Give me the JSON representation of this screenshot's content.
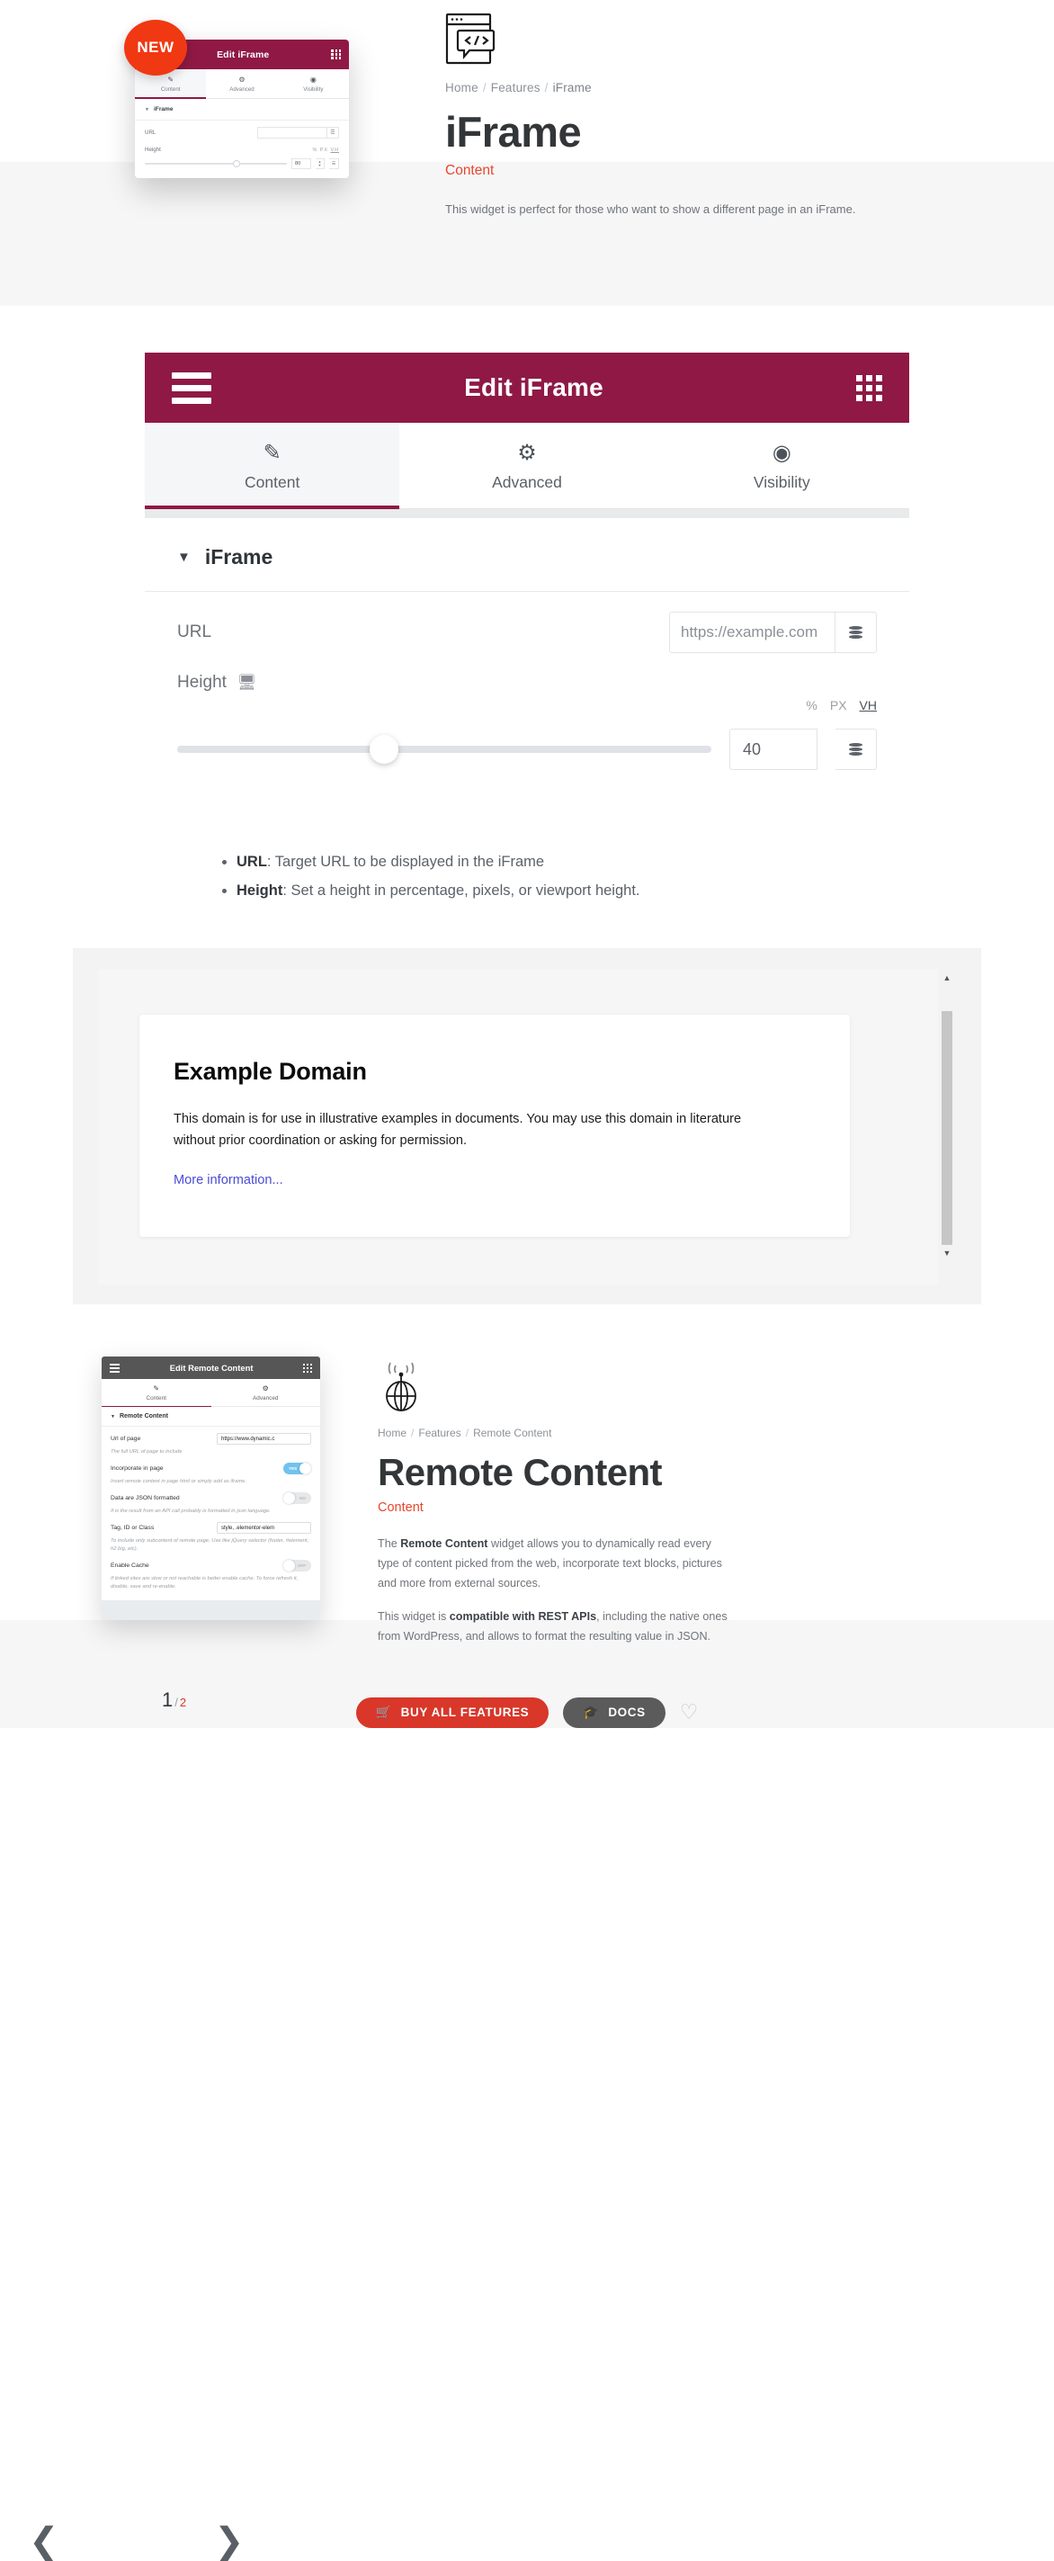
{
  "hero": {
    "breadcrumb": [
      {
        "label": "Home",
        "sep": "/"
      },
      {
        "label": "Features",
        "sep": "/"
      },
      {
        "label": "iFrame",
        "sep": ""
      }
    ],
    "title": "iFrame",
    "subtitle": "Content",
    "description": "This widget is perfect for those who want to show a different page in an iFrame.",
    "badge": "NEW",
    "icon_name": "browser-code-icon"
  },
  "mini_mock": {
    "bar_title": "Edit iFrame",
    "tabs": [
      {
        "label": "Content",
        "icon": "pencil-icon",
        "active": true
      },
      {
        "label": "Advanced",
        "icon": "gear-icon",
        "active": false
      },
      {
        "label": "Visibility",
        "icon": "eye-icon",
        "active": false
      }
    ],
    "section": "iFrame",
    "url_label": "URL",
    "url_value": "",
    "height_label": "Height",
    "units": [
      "%",
      "PX",
      "VH"
    ],
    "height_value": "80"
  },
  "panel": {
    "bar_title": "Edit iFrame",
    "menu_icon": "hamburger-icon",
    "grid_icon": "apps-grid-icon",
    "tabs": [
      {
        "label": "Content",
        "icon": "pencil-icon",
        "glyph": "✎",
        "active": true
      },
      {
        "label": "Advanced",
        "icon": "gear-icon",
        "glyph": "⚙",
        "active": false
      },
      {
        "label": "Visibility",
        "icon": "eye-icon",
        "glyph": "◉",
        "active": false
      }
    ],
    "section_title": "iFrame",
    "url": {
      "label": "URL",
      "placeholder": "https://example.com",
      "value": "https://example.com",
      "dynamic_icon": "database-stack-icon"
    },
    "height": {
      "label": "Height",
      "device_icon": "desktop-icon",
      "units": [
        "%",
        "PX",
        "VH"
      ],
      "active_unit": "VH",
      "value": "40",
      "slider_percent": 36,
      "dynamic_icon": "database-stack-icon"
    }
  },
  "bullets": [
    {
      "term": "URL",
      "text": ": Target URL to be displayed in the iFrame"
    },
    {
      "term": "Height",
      "text": ": Set a height in percentage, pixels, or viewport height."
    }
  ],
  "preview": {
    "heading": "Example Domain",
    "paragraph": "This domain is for use in illustrative examples in documents. You may use this domain in literature without prior coordination or asking for permission.",
    "link": "More information...",
    "scroll_up_icon": "caret-up-icon",
    "scroll_down_icon": "caret-down-icon"
  },
  "remote": {
    "breadcrumb": [
      {
        "label": "Home",
        "sep": "/"
      },
      {
        "label": "Features",
        "sep": "/"
      },
      {
        "label": "Remote Content",
        "sep": ""
      }
    ],
    "title": "Remote Content",
    "subtitle": "Content",
    "icon_name": "antenna-globe-icon",
    "paragraphs": [
      {
        "pre": "The ",
        "bold": "Remote Content",
        "post": " widget allows you to dynamically read every type of content picked from the web, incorporate text blocks, pictures and more from external sources."
      },
      {
        "pre": "This widget is ",
        "bold": "compatible with REST APIs",
        "post": ", including the native ones from WordPress, and allows to format the resulting value in JSON."
      }
    ],
    "mock": {
      "bar_title": "Edit Remote Content",
      "tabs": [
        {
          "label": "Content",
          "glyph": "✎",
          "active": true
        },
        {
          "label": "Advanced",
          "glyph": "⚙",
          "active": false
        }
      ],
      "section": "Remote Content",
      "fields": [
        {
          "label": "Url of page",
          "value": "https://www.dynamic.c",
          "hint": "The full URL of page to include",
          "type": "text"
        },
        {
          "label": "Incorporate in page",
          "toggle": "YES",
          "state": "on",
          "hint": "Insert remote content in page html or simply add as iframe.",
          "type": "toggle"
        },
        {
          "label": "Data are JSON formatted",
          "toggle": "NO",
          "state": "off",
          "hint": "If is the result from an API call probably is formatted in json language.",
          "type": "toggle"
        },
        {
          "label": "Tag, ID or Class",
          "value": "style, .elementor-elem",
          "hint": "To include only subcontent of remote page. Use like jQuery selector (footer, #element, h2.big, etc).",
          "type": "text"
        },
        {
          "label": "Enable Cache",
          "toggle": "OFF",
          "state": "off",
          "hint": "If linked sites are slow or not reachable is better enable cache. To force refresh it, disable, save and re-enable.",
          "type": "toggle"
        }
      ]
    }
  },
  "cta": {
    "buy_label": "BUY ALL FEATURES",
    "buy_icon": "basket-icon",
    "docs_label": "DOCS",
    "docs_icon": "graduate-icon",
    "favorite_icon": "heart-outline-icon"
  },
  "carousel": {
    "prev_icon": "chevron-left-icon",
    "next_icon": "chevron-right-icon",
    "current_page": "1",
    "separator": "/",
    "total_pages": "2"
  },
  "colors": {
    "brand_maroon": "#8f1944",
    "accent_red": "#e8452c",
    "buy_red": "#d8372a",
    "badge_red": "#f03813",
    "docs_gray": "#5b5b5b"
  }
}
